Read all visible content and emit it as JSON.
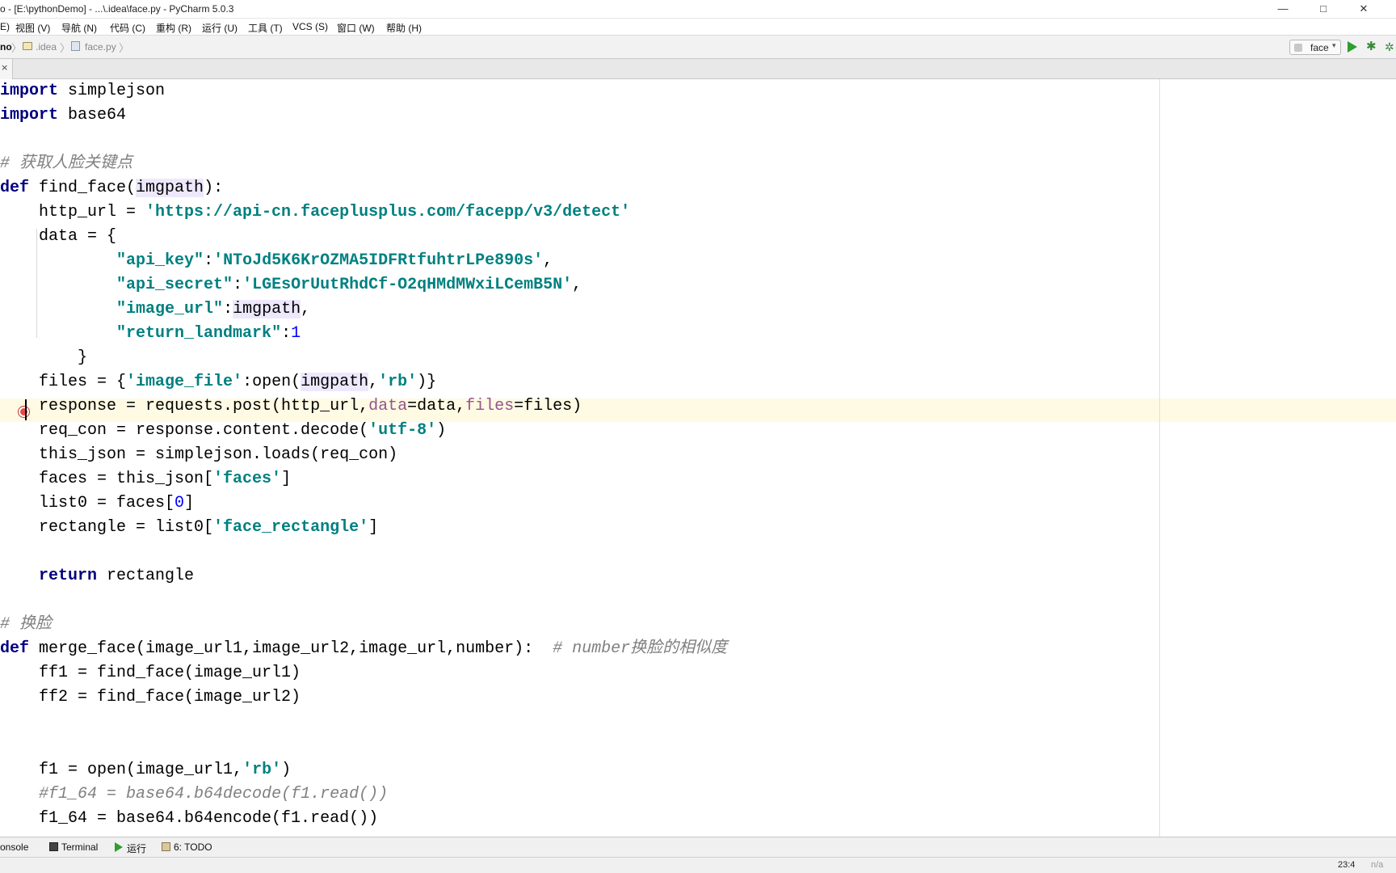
{
  "window": {
    "title": "o - [E:\\pythonDemo] - ...\\.idea\\face.py - PyCharm 5.0.3",
    "minimize": "—",
    "maximize": "□",
    "close": "✕"
  },
  "menu": [
    {
      "label": "E)"
    },
    {
      "label": "视图 (V)"
    },
    {
      "label": "导航 (N)"
    },
    {
      "label": "代码 (C)"
    },
    {
      "label": "重构 (R)"
    },
    {
      "label": "运行 (U)"
    },
    {
      "label": "工具 (T)"
    },
    {
      "label": "VCS (S)"
    },
    {
      "label": "窗口 (W)"
    },
    {
      "label": "帮助 (H)"
    }
  ],
  "nav": {
    "project": "no",
    "folder": ".idea",
    "file": "face.py",
    "run_config": "face",
    "run_config_caret": "▾",
    "sep": "〉",
    "debug_glyph": "✱",
    "coverage_glyph": "✲"
  },
  "tab": {
    "close": "×"
  },
  "editor": {
    "caret_line": 14,
    "breakpoint_line": 14,
    "lines": [
      "import simplejson",
      "import base64",
      "",
      "# 获取人脸关键点",
      "def find_face(imgpath):",
      "    http_url = 'https://api-cn.faceplusplus.com/facepp/v3/detect'",
      "    data = {",
      "            \"api_key\":'NToJd5K6KrOZMA5IDFRtfuhtrLPe890s',",
      "            \"api_secret\":'LGEsOrUutRhdCf-O2qHMdMWxiLCemB5N',",
      "            \"image_url\":imgpath,",
      "            \"return_landmark\":1",
      "        }",
      "    files = {'image_file':open(imgpath,'rb')}",
      "    response = requests.post(http_url,data=data,files=files)",
      "    req_con = response.content.decode('utf-8')",
      "    this_json = simplejson.loads(req_con)",
      "    faces = this_json['faces']",
      "    list0 = faces[0]",
      "    rectangle = list0['face_rectangle']",
      "",
      "    return rectangle",
      "",
      "# 换脸",
      "def merge_face(image_url1,image_url2,image_url,number):  # number换脸的相似度",
      "    ff1 = find_face(image_url1)",
      "    ff2 = find_face(image_url2)",
      "",
      "",
      "    f1 = open(image_url1,'rb')",
      "    #f1_64 = base64.b64decode(f1.read())",
      "    f1_64 = base64.b64encode(f1.read())"
    ]
  },
  "tool_windows": [
    {
      "label": "onsole"
    },
    {
      "label": "Terminal"
    },
    {
      "label": "运行"
    },
    {
      "label": "6: TODO"
    }
  ],
  "status": {
    "position": "23:4",
    "encoding": "n/a"
  },
  "colors": {
    "keyword": "#000080",
    "string": "#008080",
    "comment": "#808080",
    "number": "#0000ff",
    "parameter": "#94558d",
    "caret_row": "#fffae3"
  }
}
